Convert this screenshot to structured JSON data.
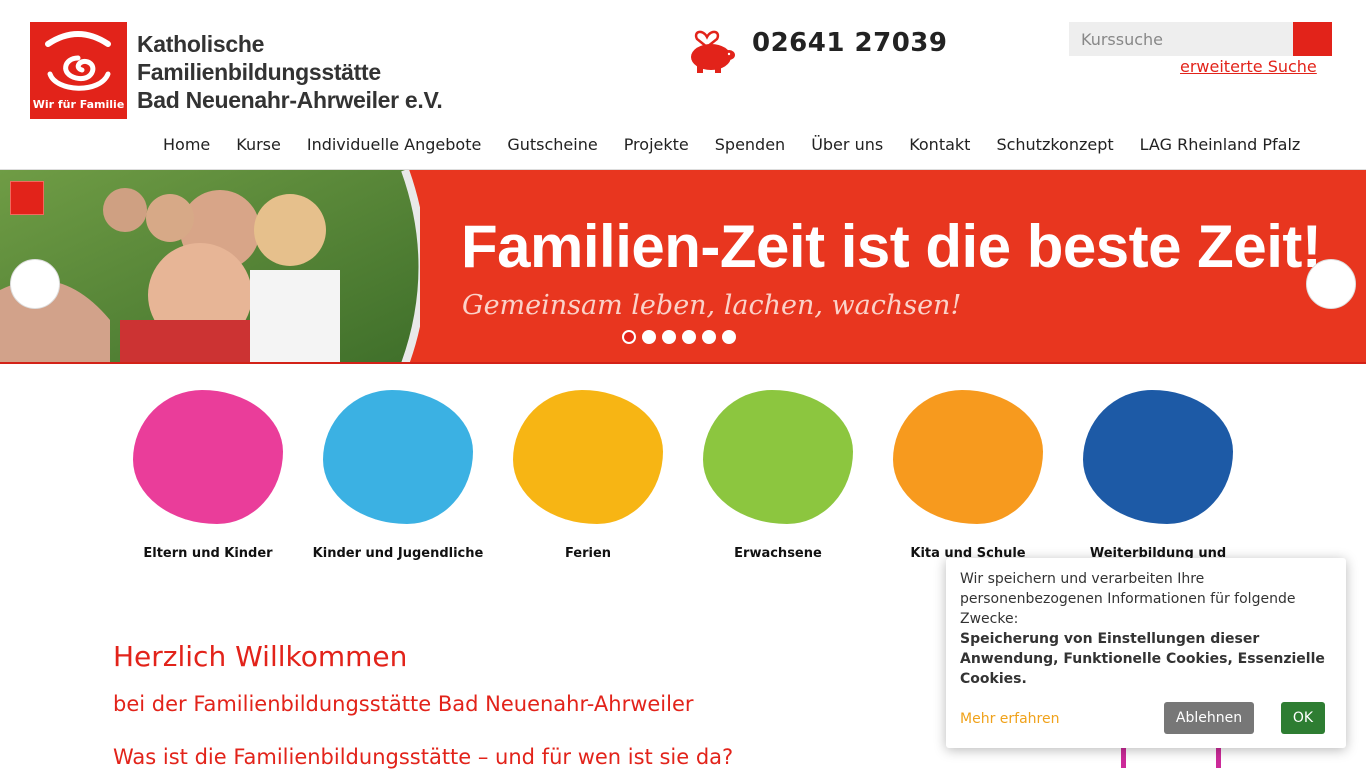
{
  "header": {
    "logo_tagline": "Wir für Familie",
    "logo_lines": [
      "Katholische",
      "Familienbildungsstätte",
      "Bad Neuenahr-Ahrweiler e.V."
    ],
    "phone_icon": "",
    "phone": "02641 27039",
    "icons": [
      "",
      ""
    ],
    "search_placeholder": "Kurssuche",
    "search_button": "",
    "advanced_search": " erweiterte Suche"
  },
  "nav": [
    "Home",
    "Kurse",
    "Individuelle Angebote",
    "Gutscheine",
    "Projekte",
    "Spenden",
    "Über uns",
    "Kontakt",
    "Schutzkonzept",
    "LAG Rheinland Pfalz"
  ],
  "hero": {
    "pause": "",
    "title": "Familien-Zeit ist die beste Zeit!",
    "subtitle": "Gemeinsam leben, lachen, wachsen!",
    "prev": "",
    "next": "",
    "slides": 6,
    "active_slide": 1
  },
  "categories": [
    {
      "label": "Eltern und Kinder",
      "color": "#ea3d9a"
    },
    {
      "label": "Kinder und Jugendliche",
      "color": "#3bb1e3"
    },
    {
      "label": "Ferien",
      "color": "#f7b514"
    },
    {
      "label": "Erwachsene",
      "color": "#8cc63f"
    },
    {
      "label": "Kita und Schule",
      "color": "#f79a1e"
    },
    {
      "label": "Weiterbildung und",
      "color": "#1d5aa6"
    }
  ],
  "welcome": {
    "title": "Herzlich Willkommen",
    "subtitle": "bei der Familienbildungsstätte Bad Neuenahr-Ahrweiler ",
    "question": "Was ist die Familienbildungsstätte – und für wen ist sie da?"
  },
  "cookie": {
    "intro": "Wir speichern und verarbeiten Ihre personenbezogenen Informationen für folgende Zwecke:",
    "purposes": "Speicherung von Einstellungen dieser Anwendung, Funktionelle Cookies, Essenzielle Cookies.",
    "more": "Mehr erfahren",
    "decline": "Ablehnen",
    "ok": "OK"
  },
  "colors": {
    "accent": "#e2231a",
    "hero_bg": "#e8361f",
    "ok_green": "#2e7d32"
  }
}
